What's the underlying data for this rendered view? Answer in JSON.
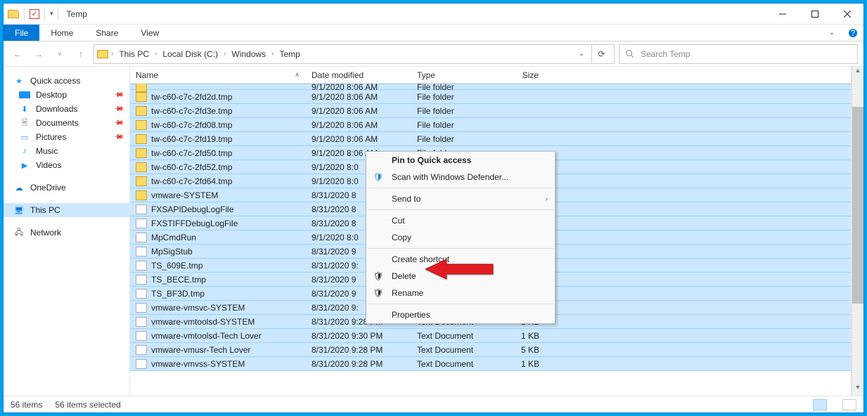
{
  "window": {
    "title": "Temp"
  },
  "ribbon": {
    "file": "File",
    "tabs": [
      "Home",
      "Share",
      "View"
    ]
  },
  "breadcrumbs": [
    "This PC",
    "Local Disk (C:)",
    "Windows",
    "Temp"
  ],
  "search": {
    "placeholder": "Search Temp"
  },
  "sidebar": {
    "quick": [
      {
        "label": "Quick access",
        "icon": "star",
        "color": "#1e90ff",
        "bold": true
      },
      {
        "label": "Desktop",
        "icon": "desktop",
        "color": "#1e90ff",
        "pin": true
      },
      {
        "label": "Downloads",
        "icon": "download",
        "color": "#1e90ff",
        "pin": true
      },
      {
        "label": "Documents",
        "icon": "doc",
        "color": "#777",
        "pin": true
      },
      {
        "label": "Pictures",
        "icon": "image",
        "color": "#1e90ff",
        "pin": true
      },
      {
        "label": "Music",
        "icon": "music",
        "color": "#1e90ff",
        "pin": false
      },
      {
        "label": "Videos",
        "icon": "video",
        "color": "#1e90ff",
        "pin": false
      }
    ],
    "onedrive": {
      "label": "OneDrive"
    },
    "thispc": {
      "label": "This PC"
    },
    "network": {
      "label": "Network"
    }
  },
  "columns": {
    "name": "Name",
    "date": "Date modified",
    "type": "Type",
    "size": "Size"
  },
  "rows": [
    {
      "name": "tw-c60-c7c-2fd2d.tmp",
      "date": "9/1/2020 8:06 AM",
      "type": "File folder",
      "size": "",
      "icon": "folder"
    },
    {
      "name": "tw-c60-c7c-2fd3e.tmp",
      "date": "9/1/2020 8:06 AM",
      "type": "File folder",
      "size": "",
      "icon": "folder"
    },
    {
      "name": "tw-c60-c7c-2fd08.tmp",
      "date": "9/1/2020 8:06 AM",
      "type": "File folder",
      "size": "",
      "icon": "folder"
    },
    {
      "name": "tw-c60-c7c-2fd19.tmp",
      "date": "9/1/2020 8:06 AM",
      "type": "File folder",
      "size": "",
      "icon": "folder"
    },
    {
      "name": "tw-c60-c7c-2fd50.tmp",
      "date": "9/1/2020 8:06 AM",
      "type": "File folder",
      "size": "",
      "icon": "folder"
    },
    {
      "name": "tw-c60-c7c-2fd52.tmp",
      "date": "9/1/2020 8:0",
      "type": "",
      "size": "",
      "icon": "folder"
    },
    {
      "name": "tw-c60-c7c-2fd64.tmp",
      "date": "9/1/2020 8:0",
      "type": "",
      "size": "",
      "icon": "folder"
    },
    {
      "name": "vmware-SYSTEM",
      "date": "8/31/2020 8",
      "type": "",
      "size": "",
      "icon": "folder"
    },
    {
      "name": "FXSAPIDebugLogFile",
      "date": "8/31/2020 8",
      "type": "",
      "size": "",
      "icon": "file"
    },
    {
      "name": "FXSTIFFDebugLogFile",
      "date": "8/31/2020 8",
      "type": "",
      "size": "",
      "icon": "file"
    },
    {
      "name": "MpCmdRun",
      "date": "9/1/2020 8:0",
      "type": "",
      "size": "",
      "icon": "file"
    },
    {
      "name": "MpSigStub",
      "date": "8/31/2020 9",
      "type": "",
      "size": "",
      "icon": "file"
    },
    {
      "name": "TS_609E.tmp",
      "date": "8/31/2020 9:",
      "type": "",
      "size": "",
      "icon": "file"
    },
    {
      "name": "TS_BECE.tmp",
      "date": "8/31/2020 9",
      "type": "",
      "size": "",
      "icon": "file"
    },
    {
      "name": "TS_BF3D.tmp",
      "date": "8/31/2020 9",
      "type": "",
      "size": "",
      "icon": "file"
    },
    {
      "name": "vmware-vmsvc-SYSTEM",
      "date": "8/31/2020 9:",
      "type": "",
      "size": "",
      "icon": "file"
    },
    {
      "name": "vmware-vmtoolsd-SYSTEM",
      "date": "8/31/2020 9:28 PM",
      "type": "Text Document",
      "size": "1 KB",
      "icon": "file"
    },
    {
      "name": "vmware-vmtoolsd-Tech Lover",
      "date": "8/31/2020 9:30 PM",
      "type": "Text Document",
      "size": "1 KB",
      "icon": "file"
    },
    {
      "name": "vmware-vmusr-Tech Lover",
      "date": "8/31/2020 9:28 PM",
      "type": "Text Document",
      "size": "5 KB",
      "icon": "file"
    },
    {
      "name": "vmware-vmvss-SYSTEM",
      "date": "8/31/2020 9:28 PM",
      "type": "Text Document",
      "size": "1 KB",
      "icon": "file"
    }
  ],
  "partial_top_row": {
    "date": "9/1/2020 8:06 AM",
    "type": "File folder"
  },
  "ctx": {
    "pin": "Pin to Quick access",
    "defender": "Scan with Windows Defender...",
    "sendto": "Send to",
    "cut": "Cut",
    "copy": "Copy",
    "shortcut": "Create shortcut",
    "delete": "Delete",
    "rename": "Rename",
    "properties": "Properties"
  },
  "status": {
    "count": "56 items",
    "selected": "56 items selected"
  }
}
